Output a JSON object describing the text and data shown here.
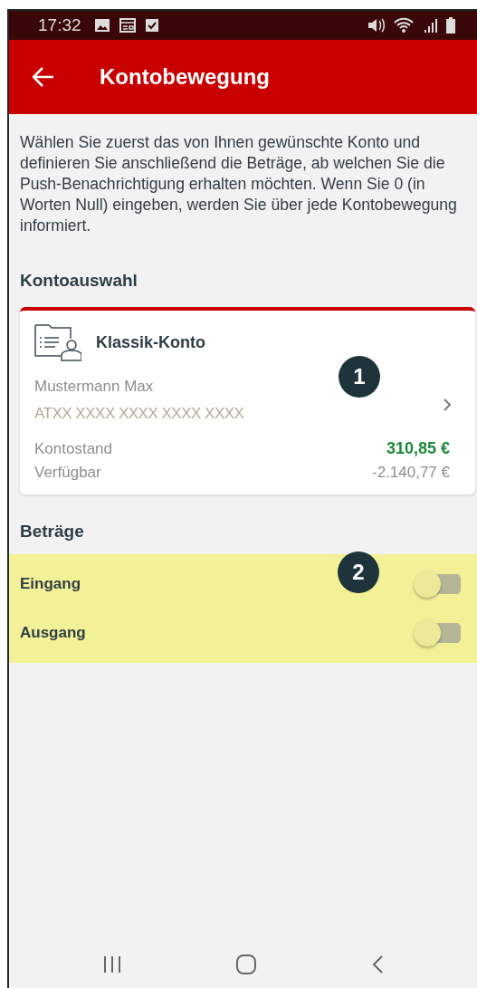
{
  "status_bar": {
    "time": "17:32"
  },
  "app_bar": {
    "title": "Kontobewegung"
  },
  "intro": "Wählen Sie zuerst das von Ihnen gewünschte Konto und definieren Sie anschließend die Beträge, ab welchen Sie die Push-Benachrichtigung erhalten möchten. Wenn Sie 0 (in Worten Null) eingeben, werden Sie über jede Kontobewegung informiert.",
  "account_section": {
    "title": "Kontoauswahl"
  },
  "account": {
    "name": "Klassik-Konto",
    "holder": "Mustermann Max",
    "iban": "ATXX XXXX XXXX XXXX XXXX",
    "balance_label": "Kontostand",
    "balance": "310,85 €",
    "available_label": "Verfügbar",
    "available": "-2.140,77 €"
  },
  "amounts_section": {
    "title": "Beträge"
  },
  "toggles": [
    {
      "label": "Eingang",
      "on": false
    },
    {
      "label": "Ausgang",
      "on": false
    }
  ],
  "markers": [
    "1",
    "2"
  ]
}
